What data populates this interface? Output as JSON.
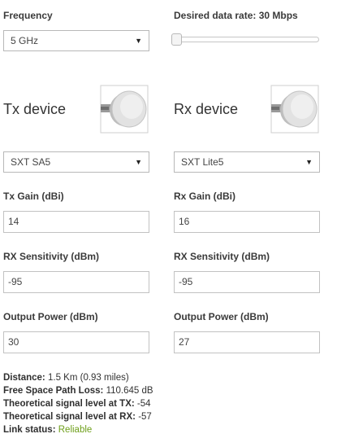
{
  "frequency": {
    "label": "Frequency",
    "selected": "5 GHz"
  },
  "data_rate": {
    "label": "Desired data rate: 30 Mbps",
    "level": 0.0
  },
  "tx": {
    "title": "Tx device",
    "device": "SXT SA5",
    "gain_label": "Tx Gain (dBi)",
    "gain_value": "14",
    "sens_label": "RX Sensitivity (dBm)",
    "sens_value": "-95",
    "power_label": "Output Power (dBm)",
    "power_value": "30"
  },
  "rx": {
    "title": "Rx device",
    "device": "SXT Lite5",
    "gain_label": "Rx Gain (dBi)",
    "gain_value": "16",
    "sens_label": "RX Sensitivity (dBm)",
    "sens_value": "-95",
    "power_label": "Output Power (dBm)",
    "power_value": "27"
  },
  "summary": {
    "distance_label": "Distance:",
    "distance_value": "1.5 Km (0.93 miles)",
    "fspl_label": "Free Space Path Loss:",
    "fspl_value": "110.645 dB",
    "tx_level_label": "Theoretical signal level at TX:",
    "tx_level_value": "-54",
    "rx_level_label": "Theoretical signal level at RX:",
    "rx_level_value": "-57",
    "link_label": "Link status:",
    "link_value": "Reliable"
  },
  "icons": {
    "dropdown": "caret-down-icon",
    "device_image": "sxt-antenna-icon"
  },
  "colors": {
    "link_reliable": "#6e9f1a",
    "border": "#b8b8b8"
  }
}
